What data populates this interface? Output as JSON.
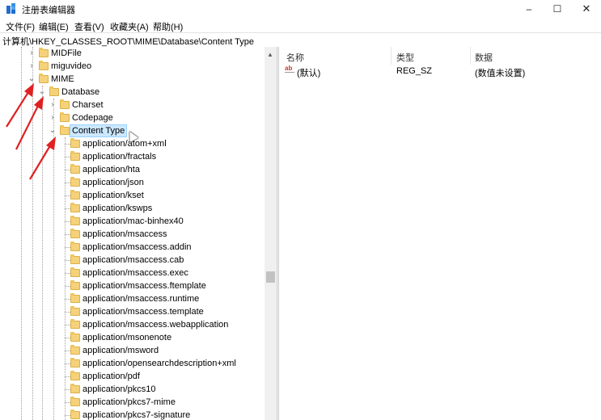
{
  "window": {
    "title": "注册表编辑器",
    "controls": {
      "minimize": "–",
      "maximize": "☐",
      "close": "✕"
    }
  },
  "menu": {
    "items": [
      {
        "label": "文件(F)"
      },
      {
        "label": "编辑(E)"
      },
      {
        "label": "查看(V)"
      },
      {
        "label": "收藏夹(A)"
      },
      {
        "label": "帮助(H)"
      }
    ]
  },
  "address": {
    "path": "计算机\\HKEY_CLASSES_ROOT\\MIME\\Database\\Content Type"
  },
  "tree": {
    "nodes": [
      {
        "label": "MIDFile",
        "toggle": "›",
        "level": 0
      },
      {
        "label": "miguvideo",
        "toggle": "›",
        "level": 0
      },
      {
        "label": "MIME",
        "toggle": "⌄",
        "level": 0
      },
      {
        "label": "Database",
        "toggle": "⌄",
        "level": 1
      },
      {
        "label": "Charset",
        "toggle": "›",
        "level": 2
      },
      {
        "label": "Codepage",
        "toggle": "›",
        "level": 2
      },
      {
        "label": "Content Type",
        "toggle": "⌄",
        "level": 2,
        "selected": true
      },
      {
        "label": "application/atom+xml",
        "level": 3
      },
      {
        "label": "application/fractals",
        "level": 3
      },
      {
        "label": "application/hta",
        "level": 3
      },
      {
        "label": "application/json",
        "level": 3
      },
      {
        "label": "application/kset",
        "level": 3
      },
      {
        "label": "application/kswps",
        "level": 3
      },
      {
        "label": "application/mac-binhex40",
        "level": 3
      },
      {
        "label": "application/msaccess",
        "level": 3
      },
      {
        "label": "application/msaccess.addin",
        "level": 3
      },
      {
        "label": "application/msaccess.cab",
        "level": 3
      },
      {
        "label": "application/msaccess.exec",
        "level": 3
      },
      {
        "label": "application/msaccess.ftemplate",
        "level": 3
      },
      {
        "label": "application/msaccess.runtime",
        "level": 3
      },
      {
        "label": "application/msaccess.template",
        "level": 3
      },
      {
        "label": "application/msaccess.webapplication",
        "level": 3
      },
      {
        "label": "application/msonenote",
        "level": 3
      },
      {
        "label": "application/msword",
        "level": 3
      },
      {
        "label": "application/opensearchdescription+xml",
        "level": 3
      },
      {
        "label": "application/pdf",
        "level": 3
      },
      {
        "label": "application/pkcs10",
        "level": 3
      },
      {
        "label": "application/pkcs7-mime",
        "level": 3
      },
      {
        "label": "application/pkcs7-signature",
        "level": 3
      }
    ]
  },
  "values": {
    "columns": {
      "name": "名称",
      "type": "类型",
      "data": "数据"
    },
    "rows": [
      {
        "name": "(默认)",
        "type": "REG_SZ",
        "data": "(数值未设置)",
        "icon": "ab-string-icon"
      }
    ]
  },
  "colors": {
    "selection_bg": "#cce8ff",
    "folder": "#f5d27a",
    "annotation_arrow": "#e02020"
  }
}
